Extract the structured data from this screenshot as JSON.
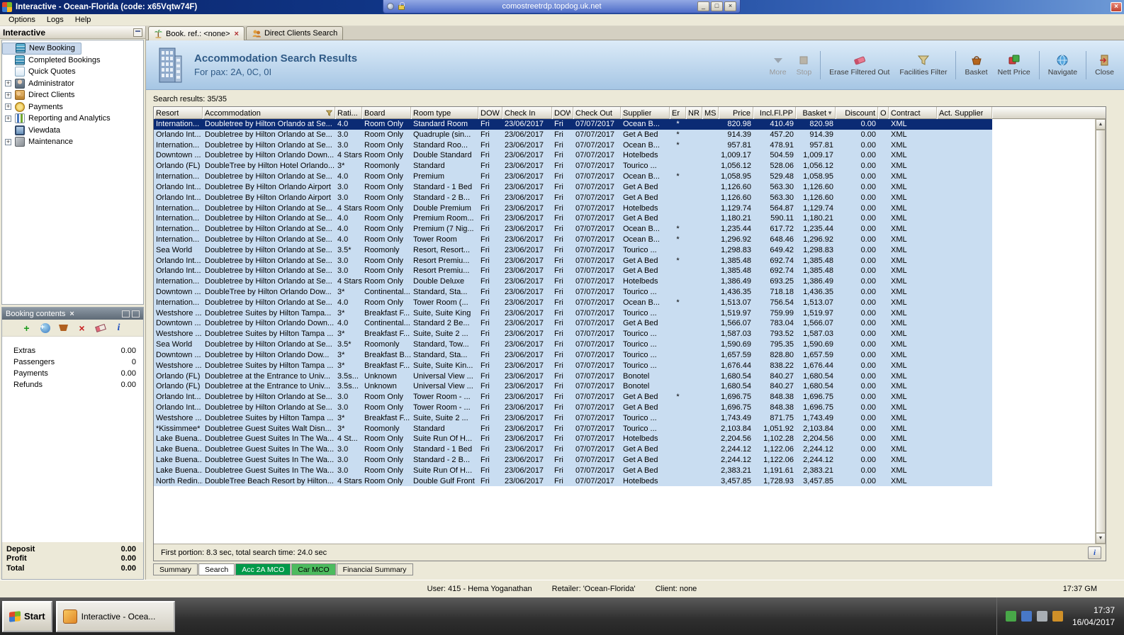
{
  "titlebar": {
    "title": "Interactive - Ocean-Florida (code: x65Vqtw74F)",
    "rdp_server": "comostreetrdp.topdog.uk.net"
  },
  "menubar": {
    "items": [
      "Options",
      "Logs",
      "Help"
    ]
  },
  "sidebar": {
    "title": "Interactive",
    "items": [
      {
        "label": "New Booking",
        "icon": "new-booking",
        "expandable": false,
        "selected": true
      },
      {
        "label": "Completed Bookings",
        "icon": "completed-bookings",
        "expandable": false
      },
      {
        "label": "Quick Quotes",
        "icon": "quick-quotes",
        "expandable": false
      },
      {
        "label": "Administrator",
        "icon": "administrator",
        "expandable": true
      },
      {
        "label": "Direct Clients",
        "icon": "direct-clients",
        "expandable": true
      },
      {
        "label": "Payments",
        "icon": "payments",
        "expandable": true
      },
      {
        "label": "Reporting and Analytics",
        "icon": "reporting",
        "expandable": true
      },
      {
        "label": "Viewdata",
        "icon": "viewdata",
        "expandable": false
      },
      {
        "label": "Maintenance",
        "icon": "maintenance",
        "expandable": true
      }
    ]
  },
  "booking_contents": {
    "title": "Booking contents",
    "rows": [
      {
        "label": "Extras",
        "value": "0.00"
      },
      {
        "label": "Passengers",
        "value": "0"
      },
      {
        "label": "Payments",
        "value": "0.00"
      },
      {
        "label": "Refunds",
        "value": "0.00"
      }
    ],
    "totals": [
      {
        "label": "Deposit",
        "value": "0.00"
      },
      {
        "label": "Profit",
        "value": "0.00"
      },
      {
        "label": "Total",
        "value": "0.00"
      }
    ]
  },
  "doc_tabs": [
    {
      "label": "Book. ref.: <none>",
      "active": true
    },
    {
      "label": "Direct Clients Search",
      "active": false
    }
  ],
  "header": {
    "title": "Accommodation Search Results",
    "subtitle": "For pax: 2A, 0C, 0I",
    "buttons": [
      {
        "label": "More",
        "disabled": true
      },
      {
        "label": "Stop",
        "disabled": true,
        "sep_after": true
      },
      {
        "label": "Erase Filtered Out"
      },
      {
        "label": "Facilities Filter",
        "sep_after": true
      },
      {
        "label": "Basket"
      },
      {
        "label": "Nett Price",
        "sep_after": true
      },
      {
        "label": "Navigate",
        "sep_after": true
      },
      {
        "label": "Close"
      }
    ]
  },
  "results": {
    "count_label": "Search results: 35/35",
    "footer_status": "First portion: 8.3 sec, total search time: 24.0 sec",
    "columns": [
      "Resort",
      "Accommodation",
      "Rati...",
      "Board",
      "Room type",
      "DOW",
      "Check In",
      "DOW",
      "Check Out",
      "Supplier",
      "Er",
      "NR",
      "MS",
      "Price",
      "Incl.Fl.PP",
      "Basket",
      "Discount",
      "Of",
      "Contract",
      "Act. Supplier"
    ],
    "rows": [
      [
        "Internation...",
        "Doubletree by Hilton Orlando at Se...",
        "4.0",
        "Room Only",
        "Standard Room",
        "Fri",
        "23/06/2017",
        "Fri",
        "07/07/2017",
        "Ocean B...",
        "*",
        "820.98",
        "410.49",
        "820.98",
        "0.00",
        "XML"
      ],
      [
        "Orlando Int...",
        "Doubletree by Hilton Orlando at Se...",
        "3.0",
        "Room Only",
        "Quadruple (sin...",
        "Fri",
        "23/06/2017",
        "Fri",
        "07/07/2017",
        "Get A Bed",
        "*",
        "914.39",
        "457.20",
        "914.39",
        "0.00",
        "XML"
      ],
      [
        "Internation...",
        "Doubletree by Hilton Orlando at Se...",
        "3.0",
        "Room Only",
        "Standard Roo...",
        "Fri",
        "23/06/2017",
        "Fri",
        "07/07/2017",
        "Ocean B...",
        "*",
        "957.81",
        "478.91",
        "957.81",
        "0.00",
        "XML"
      ],
      [
        "Downtown ...",
        "Doubletree by Hilton Orlando Down...",
        "4 Stars",
        "Room Only",
        "Double Standard",
        "Fri",
        "23/06/2017",
        "Fri",
        "07/07/2017",
        "Hotelbeds",
        "",
        "1,009.17",
        "504.59",
        "1,009.17",
        "0.00",
        "XML"
      ],
      [
        "Orlando (FL)",
        "DoubleTree by Hilton Hotel Orlando...",
        "3*",
        "Roomonly",
        "Standard",
        "Fri",
        "23/06/2017",
        "Fri",
        "07/07/2017",
        "Tourico ...",
        "",
        "1,056.12",
        "528.06",
        "1,056.12",
        "0.00",
        "XML"
      ],
      [
        "Internation...",
        "Doubletree by Hilton Orlando at Se...",
        "4.0",
        "Room Only",
        "Premium",
        "Fri",
        "23/06/2017",
        "Fri",
        "07/07/2017",
        "Ocean B...",
        "*",
        "1,058.95",
        "529.48",
        "1,058.95",
        "0.00",
        "XML"
      ],
      [
        "Orlando Int...",
        "Doubletree By Hilton Orlando Airport",
        "3.0",
        "Room Only",
        "Standard - 1 Bed",
        "Fri",
        "23/06/2017",
        "Fri",
        "07/07/2017",
        "Get A Bed",
        "",
        "1,126.60",
        "563.30",
        "1,126.60",
        "0.00",
        "XML"
      ],
      [
        "Orlando Int...",
        "Doubletree By Hilton Orlando Airport",
        "3.0",
        "Room Only",
        "Standard - 2 B...",
        "Fri",
        "23/06/2017",
        "Fri",
        "07/07/2017",
        "Get A Bed",
        "",
        "1,126.60",
        "563.30",
        "1,126.60",
        "0.00",
        "XML"
      ],
      [
        "Internation...",
        "Doubletree by Hilton Orlando at Se...",
        "4 Stars",
        "Room Only",
        "Double Premium",
        "Fri",
        "23/06/2017",
        "Fri",
        "07/07/2017",
        "Hotelbeds",
        "",
        "1,129.74",
        "564.87",
        "1,129.74",
        "0.00",
        "XML"
      ],
      [
        "Internation...",
        "Doubletree by Hilton Orlando at Se...",
        "4.0",
        "Room Only",
        "Premium Room...",
        "Fri",
        "23/06/2017",
        "Fri",
        "07/07/2017",
        "Get A Bed",
        "",
        "1,180.21",
        "590.11",
        "1,180.21",
        "0.00",
        "XML"
      ],
      [
        "Internation...",
        "Doubletree by Hilton Orlando at Se...",
        "4.0",
        "Room Only",
        "Premium (7 Nig...",
        "Fri",
        "23/06/2017",
        "Fri",
        "07/07/2017",
        "Ocean B...",
        "*",
        "1,235.44",
        "617.72",
        "1,235.44",
        "0.00",
        "XML"
      ],
      [
        "Internation...",
        "Doubletree by Hilton Orlando at Se...",
        "4.0",
        "Room Only",
        "Tower Room",
        "Fri",
        "23/06/2017",
        "Fri",
        "07/07/2017",
        "Ocean B...",
        "*",
        "1,296.92",
        "648.46",
        "1,296.92",
        "0.00",
        "XML"
      ],
      [
        "Sea World",
        "Doubletree by Hilton Orlando at Se...",
        "3.5*",
        "Roomonly",
        "Resort, Resort...",
        "Fri",
        "23/06/2017",
        "Fri",
        "07/07/2017",
        "Tourico ...",
        "",
        "1,298.83",
        "649.42",
        "1,298.83",
        "0.00",
        "XML"
      ],
      [
        "Orlando Int...",
        "Doubletree by Hilton Orlando at Se...",
        "3.0",
        "Room Only",
        "Resort Premiu...",
        "Fri",
        "23/06/2017",
        "Fri",
        "07/07/2017",
        "Get A Bed",
        "*",
        "1,385.48",
        "692.74",
        "1,385.48",
        "0.00",
        "XML"
      ],
      [
        "Orlando Int...",
        "Doubletree by Hilton Orlando at Se...",
        "3.0",
        "Room Only",
        "Resort Premiu...",
        "Fri",
        "23/06/2017",
        "Fri",
        "07/07/2017",
        "Get A Bed",
        "",
        "1,385.48",
        "692.74",
        "1,385.48",
        "0.00",
        "XML"
      ],
      [
        "Internation...",
        "Doubletree by Hilton Orlando at Se...",
        "4 Stars",
        "Room Only",
        "Double Deluxe",
        "Fri",
        "23/06/2017",
        "Fri",
        "07/07/2017",
        "Hotelbeds",
        "",
        "1,386.49",
        "693.25",
        "1,386.49",
        "0.00",
        "XML"
      ],
      [
        "Downtown ...",
        "DoubleTree by Hilton Orlando Dow...",
        "3*",
        "Continental...",
        "Standard, Sta...",
        "Fri",
        "23/06/2017",
        "Fri",
        "07/07/2017",
        "Tourico ...",
        "",
        "1,436.35",
        "718.18",
        "1,436.35",
        "0.00",
        "XML"
      ],
      [
        "Internation...",
        "Doubletree by Hilton Orlando at Se...",
        "4.0",
        "Room Only",
        "Tower Room (...",
        "Fri",
        "23/06/2017",
        "Fri",
        "07/07/2017",
        "Ocean B...",
        "*",
        "1,513.07",
        "756.54",
        "1,513.07",
        "0.00",
        "XML"
      ],
      [
        "Westshore ...",
        "Doubletree Suites by Hilton Tampa...",
        "3*",
        "Breakfast F...",
        "Suite, Suite King",
        "Fri",
        "23/06/2017",
        "Fri",
        "07/07/2017",
        "Tourico ...",
        "",
        "1,519.97",
        "759.99",
        "1,519.97",
        "0.00",
        "XML"
      ],
      [
        "Downtown ...",
        "Doubletree by Hilton Orlando Down...",
        "4.0",
        "Continental...",
        "Standard 2 Be...",
        "Fri",
        "23/06/2017",
        "Fri",
        "07/07/2017",
        "Get A Bed",
        "",
        "1,566.07",
        "783.04",
        "1,566.07",
        "0.00",
        "XML"
      ],
      [
        "Westshore ...",
        "Doubletree Suites by Hilton Tampa ...",
        "3*",
        "Breakfast F...",
        "Suite, Suite 2 ...",
        "Fri",
        "23/06/2017",
        "Fri",
        "07/07/2017",
        "Tourico ...",
        "",
        "1,587.03",
        "793.52",
        "1,587.03",
        "0.00",
        "XML"
      ],
      [
        "Sea World",
        "Doubletree by Hilton Orlando at Se...",
        "3.5*",
        "Roomonly",
        "Standard, Tow...",
        "Fri",
        "23/06/2017",
        "Fri",
        "07/07/2017",
        "Tourico ...",
        "",
        "1,590.69",
        "795.35",
        "1,590.69",
        "0.00",
        "XML"
      ],
      [
        "Downtown ...",
        "Doubletree by Hilton Orlando Dow...",
        "3*",
        "Breakfast B...",
        "Standard, Sta...",
        "Fri",
        "23/06/2017",
        "Fri",
        "07/07/2017",
        "Tourico ...",
        "",
        "1,657.59",
        "828.80",
        "1,657.59",
        "0.00",
        "XML"
      ],
      [
        "Westshore ...",
        "Doubletree Suites by Hilton Tampa ...",
        "3*",
        "Breakfast F...",
        "Suite, Suite Kin...",
        "Fri",
        "23/06/2017",
        "Fri",
        "07/07/2017",
        "Tourico ...",
        "",
        "1,676.44",
        "838.22",
        "1,676.44",
        "0.00",
        "XML"
      ],
      [
        "Orlando (FL)",
        "Doubletree at the Entrance to Univ...",
        "3.5s...",
        "Unknown",
        "Universal View ...",
        "Fri",
        "23/06/2017",
        "Fri",
        "07/07/2017",
        "Bonotel",
        "",
        "1,680.54",
        "840.27",
        "1,680.54",
        "0.00",
        "XML"
      ],
      [
        "Orlando (FL)",
        "Doubletree at the Entrance to Univ...",
        "3.5s...",
        "Unknown",
        "Universal View ...",
        "Fri",
        "23/06/2017",
        "Fri",
        "07/07/2017",
        "Bonotel",
        "",
        "1,680.54",
        "840.27",
        "1,680.54",
        "0.00",
        "XML"
      ],
      [
        "Orlando Int...",
        "Doubletree by Hilton Orlando at Se...",
        "3.0",
        "Room Only",
        "Tower Room - ...",
        "Fri",
        "23/06/2017",
        "Fri",
        "07/07/2017",
        "Get A Bed",
        "*",
        "1,696.75",
        "848.38",
        "1,696.75",
        "0.00",
        "XML"
      ],
      [
        "Orlando Int...",
        "Doubletree by Hilton Orlando at Se...",
        "3.0",
        "Room Only",
        "Tower Room - ...",
        "Fri",
        "23/06/2017",
        "Fri",
        "07/07/2017",
        "Get A Bed",
        "",
        "1,696.75",
        "848.38",
        "1,696.75",
        "0.00",
        "XML"
      ],
      [
        "Westshore ...",
        "Doubletree Suites by Hilton Tampa ...",
        "3*",
        "Breakfast F...",
        "Suite, Suite 2 ...",
        "Fri",
        "23/06/2017",
        "Fri",
        "07/07/2017",
        "Tourico ...",
        "",
        "1,743.49",
        "871.75",
        "1,743.49",
        "0.00",
        "XML"
      ],
      [
        "*Kissimmee*",
        "Doubletree Guest Suites Walt Disn...",
        "3*",
        "Roomonly",
        "Standard",
        "Fri",
        "23/06/2017",
        "Fri",
        "07/07/2017",
        "Tourico ...",
        "",
        "2,103.84",
        "1,051.92",
        "2,103.84",
        "0.00",
        "XML"
      ],
      [
        "Lake Buena...",
        "Doubletree Guest Suites In The Wa...",
        "4 St...",
        "Room Only",
        "Suite Run Of H...",
        "Fri",
        "23/06/2017",
        "Fri",
        "07/07/2017",
        "Hotelbeds",
        "",
        "2,204.56",
        "1,102.28",
        "2,204.56",
        "0.00",
        "XML"
      ],
      [
        "Lake Buena...",
        "Doubletree Guest Suites In The Wa...",
        "3.0",
        "Room Only",
        "Standard - 1 Bed",
        "Fri",
        "23/06/2017",
        "Fri",
        "07/07/2017",
        "Get A Bed",
        "",
        "2,244.12",
        "1,122.06",
        "2,244.12",
        "0.00",
        "XML"
      ],
      [
        "Lake Buena...",
        "Doubletree Guest Suites In The Wa...",
        "3.0",
        "Room Only",
        "Standard - 2 B...",
        "Fri",
        "23/06/2017",
        "Fri",
        "07/07/2017",
        "Get A Bed",
        "",
        "2,244.12",
        "1,122.06",
        "2,244.12",
        "0.00",
        "XML"
      ],
      [
        "Lake Buena...",
        "Doubletree Guest Suites In The Wa...",
        "3.0",
        "Room Only",
        "Suite Run Of H...",
        "Fri",
        "23/06/2017",
        "Fri",
        "07/07/2017",
        "Get A Bed",
        "",
        "2,383.21",
        "1,191.61",
        "2,383.21",
        "0.00",
        "XML"
      ],
      [
        "North Redin...",
        "DoubleTree Beach Resort by Hilton...",
        "4 Stars",
        "Room Only",
        "Double Gulf Front",
        "Fri",
        "23/06/2017",
        "Fri",
        "07/07/2017",
        "Hotelbeds",
        "",
        "3,457.85",
        "1,728.93",
        "3,457.85",
        "0.00",
        "XML"
      ]
    ]
  },
  "bottom_tabs": [
    {
      "label": "Summary"
    },
    {
      "label": "Search",
      "active": true
    },
    {
      "label": "Acc 2A MCO",
      "bg": "#009A49",
      "fg": "#FFFFFF"
    },
    {
      "label": "Car MCO",
      "bg": "#4CBB5E",
      "fg": "#000000"
    },
    {
      "label": "Financial Summary"
    }
  ],
  "statusbar": {
    "user": "User: 415 - Hema Yoganathan",
    "retailer": "Retailer: 'Ocean-Florida'",
    "client": "Client: none",
    "time": "17:37 GM"
  },
  "taskbar": {
    "start_label": "Start",
    "task_label": "Interactive - Ocea...",
    "tray_time": "17:37",
    "tray_date": "16/04/2017"
  }
}
